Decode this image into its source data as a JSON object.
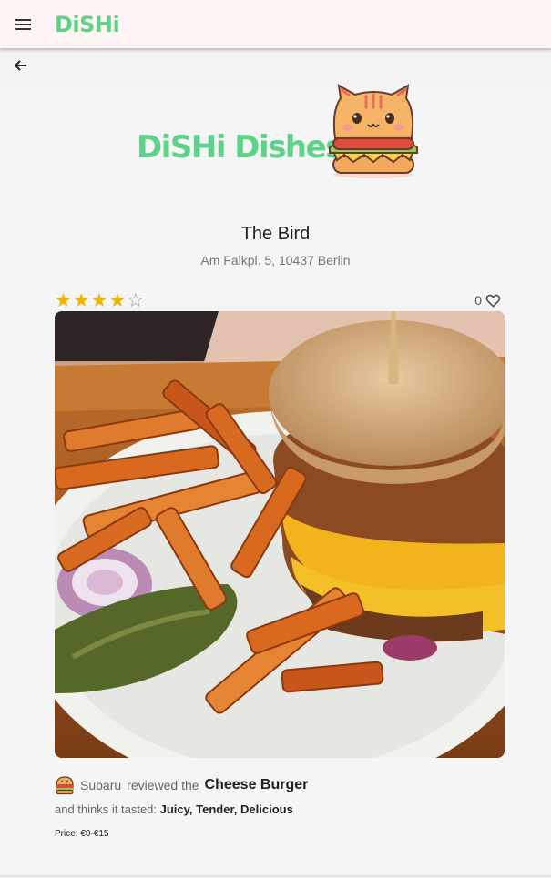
{
  "app": {
    "brand": "DiSHi"
  },
  "icons": {
    "menu": "menu-icon",
    "back": "arrow-left-icon",
    "heart": "heart-outline-icon",
    "mascot": "cat-burger-icon",
    "avatar": "burger-avatar-icon"
  },
  "hero": {
    "title": "DiSHi Dishes!"
  },
  "restaurant": {
    "name": "The Bird",
    "address": "Am Falkpl. 5, 10437 Berlin"
  },
  "rating": {
    "value": 4,
    "max": 5
  },
  "likes": {
    "count": "0"
  },
  "review": {
    "user": "Subaru",
    "reviewed_text": "reviewed the",
    "dish": "Cheese Burger",
    "thinks_text": "and thinks it tasted:",
    "tastes": "Juicy, Tender, Delicious",
    "price": "Price: €0-€15"
  },
  "colors": {
    "brand": "#5dd38a",
    "star": "#f1b400",
    "appbar": "#fff5f5",
    "background": "#f5f5f5"
  }
}
